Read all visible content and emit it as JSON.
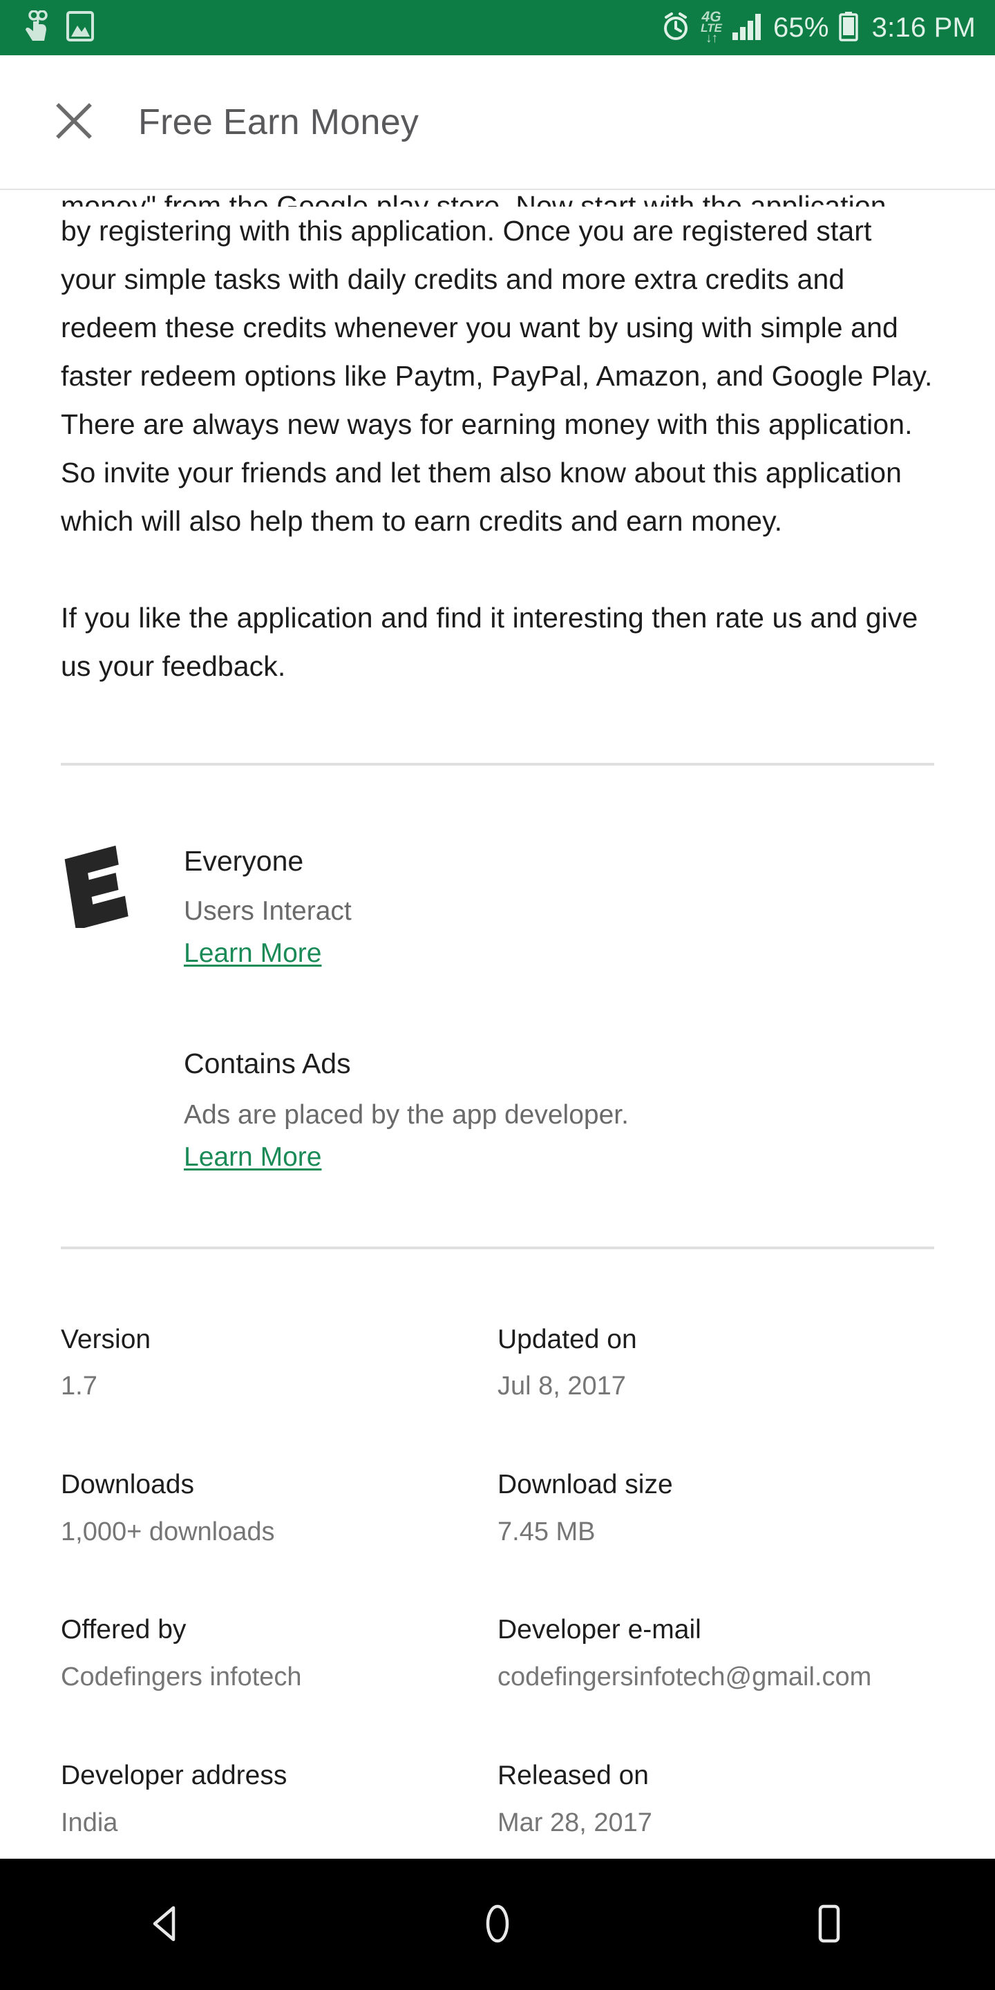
{
  "status_bar": {
    "background_color": "#0d7d45",
    "foreground_color": "#dff0e6",
    "left_icons": [
      {
        "name": "gesture-pointer-icon"
      },
      {
        "name": "screenshot-image-icon"
      }
    ],
    "alarm_icon": "alarm-clock-icon",
    "network": {
      "generation": "4G",
      "technology": "LTE"
    },
    "signal_icon": "signal-bars-icon",
    "battery_percent": "65%",
    "battery_icon": "battery-icon",
    "time": "3:16 PM"
  },
  "app_bar": {
    "close_icon": "close-icon",
    "title": "Free Earn Money"
  },
  "description": {
    "clipped_line": "money\" from the Google play store. Now start with the application",
    "paragraph_1": "by registering with this application. Once you are registered start your simple tasks with daily credits and more extra credits and redeem these credits whenever you want  by using with simple and faster redeem options like Paytm, PayPal, Amazon, and Google Play. There are always new ways for earning money with this application. So invite your friends and let them also know about this application which will also help them to earn credits and earn money.",
    "paragraph_2": "If you like the application and find it interesting then rate us and give us your feedback."
  },
  "content_rating": {
    "badge_icon": "esrb-everyone-icon",
    "badge_letter": "E",
    "title": "Everyone",
    "subtitle": "Users Interact",
    "learn_more": "Learn More",
    "link_color": "#1a8a57"
  },
  "contains_ads": {
    "title": "Contains Ads",
    "subtitle": "Ads are placed by the app developer.",
    "learn_more": "Learn More"
  },
  "app_info": {
    "version": {
      "label": "Version",
      "value": "1.7"
    },
    "updated_on": {
      "label": "Updated on",
      "value": "Jul 8, 2017"
    },
    "downloads": {
      "label": "Downloads",
      "value": "1,000+ downloads"
    },
    "download_size": {
      "label": "Download size",
      "value": "7.45 MB"
    },
    "offered_by": {
      "label": "Offered by",
      "value": "Codefingers infotech"
    },
    "developer_email": {
      "label": "Developer e-mail",
      "value": "codefingersinfotech@gmail.com"
    },
    "developer_address": {
      "label": "Developer address",
      "value": "India"
    },
    "released_on": {
      "label": "Released on",
      "value": "Mar 28, 2017"
    }
  },
  "nav_bar": {
    "background_color": "#000000",
    "buttons": [
      {
        "name": "back-button",
        "icon": "back-triangle-icon"
      },
      {
        "name": "home-button",
        "icon": "home-circle-icon"
      },
      {
        "name": "recents-button",
        "icon": "recents-square-icon"
      }
    ]
  }
}
